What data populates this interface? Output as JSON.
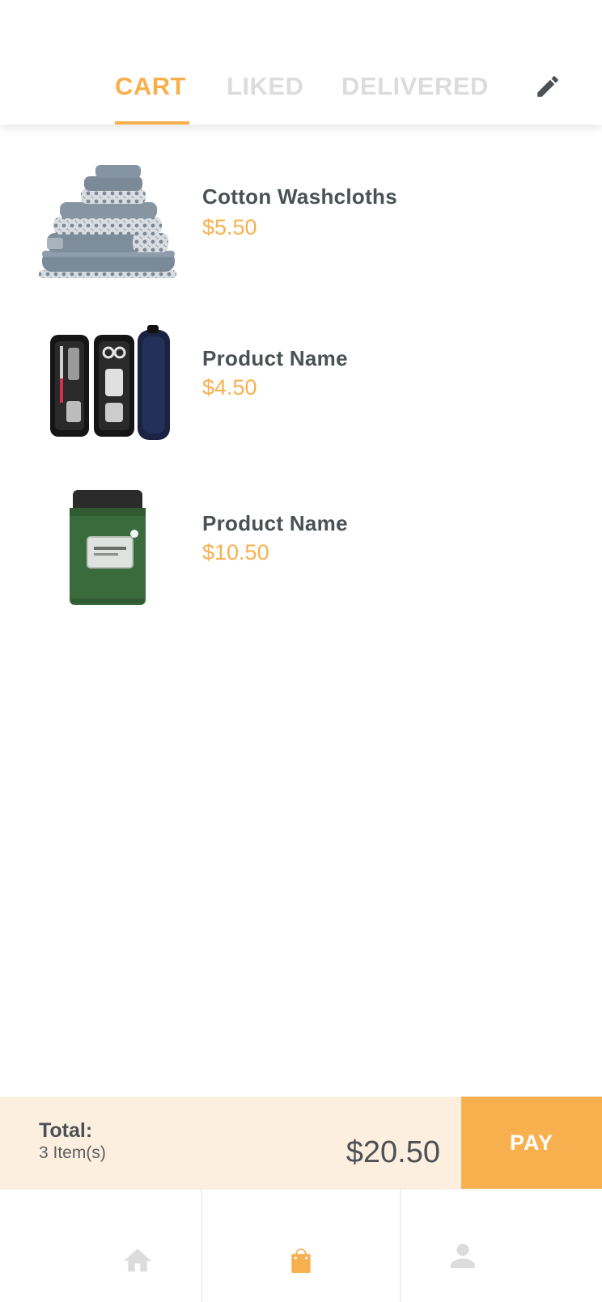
{
  "tabs": [
    {
      "label": "CART",
      "active": true
    },
    {
      "label": "LIKED",
      "active": false
    },
    {
      "label": "DELIVERED",
      "active": false
    }
  ],
  "edit_icon": "pencil-icon",
  "items": [
    {
      "name": "Cotton Washcloths",
      "price": "$5.50",
      "image": "folded-towels"
    },
    {
      "name": "Product Name",
      "price": "$4.50",
      "image": "toiletry-case"
    },
    {
      "name": "Product Name",
      "price": "$10.50",
      "image": "pocket-blanket-pouch"
    }
  ],
  "summary": {
    "total_label": "Total:",
    "item_count": "3 Item(s)",
    "amount": "$20.50",
    "pay_label": "PAY"
  },
  "bottom_nav": [
    {
      "icon": "home-icon",
      "active": false
    },
    {
      "icon": "shopping-bag-icon",
      "active": true
    },
    {
      "icon": "user-icon",
      "active": false
    }
  ],
  "colors": {
    "accent": "#f8b04e",
    "inactive_tab": "#dcdcdc",
    "text": "#4b5154",
    "total_bar_bg": "#fdefe0"
  }
}
